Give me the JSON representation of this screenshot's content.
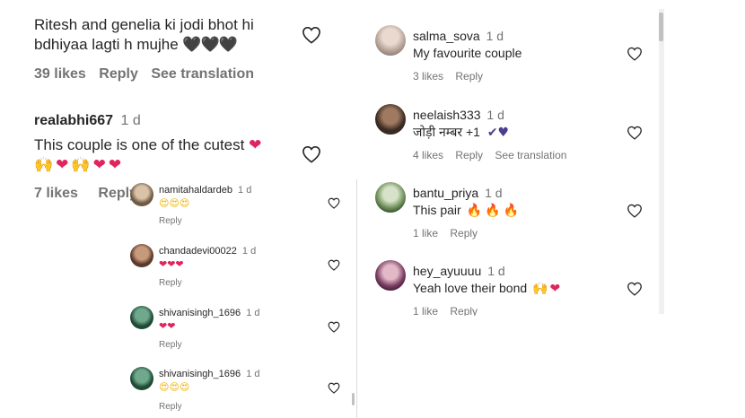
{
  "left": {
    "c1": {
      "text_line1": "Ritesh and genelia ki jodi bhot hi",
      "text_line2": "bdhiyaa lagti h mujhe",
      "emoji": "🖤🖤🖤",
      "likes": "39 likes",
      "reply": "Reply",
      "translate": "See translation"
    },
    "c2": {
      "username": "realabhi667",
      "time": "1 d",
      "text": "This couple is one of the cutest",
      "emoji_line1": "❤",
      "emoji_line2": "🙌❤🙌❤❤",
      "likes": "7 likes",
      "reply": "Reply"
    },
    "replies": [
      {
        "username": "namitahaldardeb",
        "time": "1 d",
        "emoji": "😍😍😍",
        "reply": "Reply"
      },
      {
        "username": "chandadevi00022",
        "time": "1 d",
        "emoji": "❤❤❤",
        "reply": "Reply"
      },
      {
        "username": "shivanisingh_1696",
        "time": "1 d",
        "emoji": "❤❤",
        "reply": "Reply"
      },
      {
        "username": "shivanisingh_1696",
        "time": "1 d",
        "emoji": "😍😍😍",
        "reply": "Reply"
      }
    ]
  },
  "right": {
    "comments": [
      {
        "username": "salma_sova",
        "time": "1 d",
        "text": "My favourite couple",
        "emoji": "",
        "likes": "3 likes",
        "reply": "Reply",
        "translate": ""
      },
      {
        "username": "neelaish333",
        "time": "1 d",
        "text": "जोड़ी नम्बर +1",
        "emoji": "✔♥",
        "likes": "4 likes",
        "reply": "Reply",
        "translate": "See translation"
      },
      {
        "username": "bantu_priya",
        "time": "1 d",
        "text": "This pair",
        "emoji": "🔥🔥🔥",
        "likes": "1 like",
        "reply": "Reply",
        "translate": ""
      },
      {
        "username": "hey_ayuuuu",
        "time": "1 d",
        "text": "Yeah love their bond",
        "emoji": "🙌❤",
        "likes": "1 like",
        "reply": "Reply",
        "translate": ""
      }
    ]
  },
  "colors": {
    "text": "#262626",
    "muted": "#737373",
    "heart": "#e0245e",
    "divider": "#dbdbdb"
  },
  "icons": [
    "heart-outline-icon",
    "avatar",
    "scrollbar"
  ]
}
